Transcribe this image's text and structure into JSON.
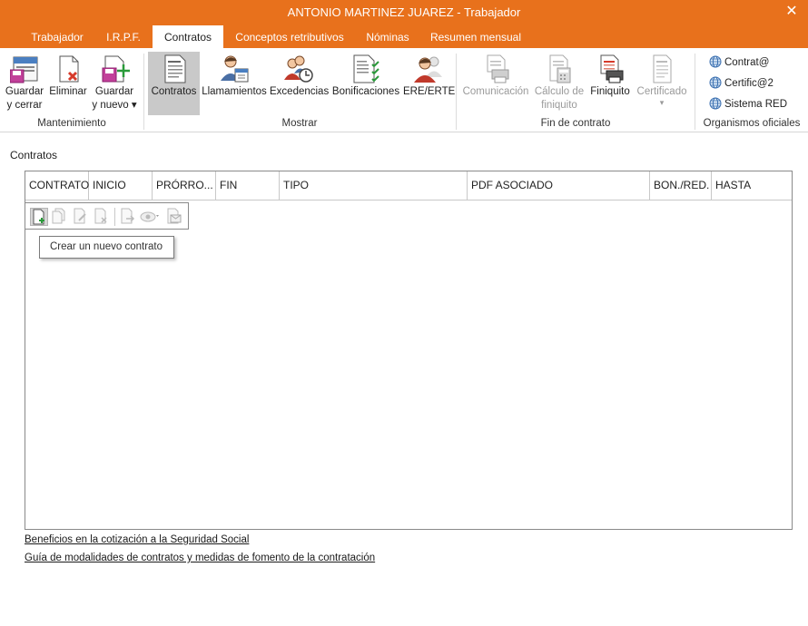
{
  "window": {
    "title": "ANTONIO MARTINEZ JUAREZ - Trabajador",
    "close_symbol": "✕"
  },
  "tabs": [
    {
      "label": "Trabajador",
      "active": false
    },
    {
      "label": "I.R.P.F.",
      "active": false
    },
    {
      "label": "Contratos",
      "active": true
    },
    {
      "label": "Conceptos retributivos",
      "active": false
    },
    {
      "label": "Nóminas",
      "active": false
    },
    {
      "label": "Resumen mensual",
      "active": false
    }
  ],
  "ribbon": {
    "mantenimiento": {
      "label": "Mantenimiento",
      "guardar_cerrar": {
        "line1": "Guardar",
        "line2": "y cerrar"
      },
      "eliminar": {
        "line1": "Eliminar"
      },
      "guardar_nuevo": {
        "line1": "Guardar",
        "line2": "y nuevo ▾"
      }
    },
    "mostrar": {
      "label": "Mostrar",
      "contratos": "Contratos",
      "llamamientos": "Llamamientos",
      "excedencias": "Excedencias",
      "bonificaciones": "Bonificaciones",
      "ere_erte": "ERE/ERTE"
    },
    "fin_contrato": {
      "label": "Fin de contrato",
      "comunicacion": "Comunicación",
      "calculo": {
        "line1": "Cálculo de",
        "line2": "finiquito"
      },
      "finiquito": "Finiquito",
      "certificado": {
        "line1": "Certificado",
        "line2": "▾"
      }
    },
    "organismos": {
      "label": "Organismos oficiales",
      "contrata": "Contrat@",
      "certifica": "Certific@2",
      "sistema_red": "Sistema RED"
    }
  },
  "contratos_section": {
    "title": "Contratos",
    "columns": [
      "CONTRATO",
      "INICIO",
      "PRÓRRO...",
      "FIN",
      "TIPO",
      "PDF ASOCIADO",
      "BON./RED.",
      "HASTA"
    ],
    "rows": [],
    "tooltip": "Crear un nuevo contrato"
  },
  "links": {
    "beneficios": "Beneficios en la cotización a la Seguridad Social",
    "guia": "Guía de modalidades de contratos y medidas de fomento de la contratación"
  },
  "colors": {
    "accent": "#e8711c",
    "selected": "#c9c9c9"
  }
}
